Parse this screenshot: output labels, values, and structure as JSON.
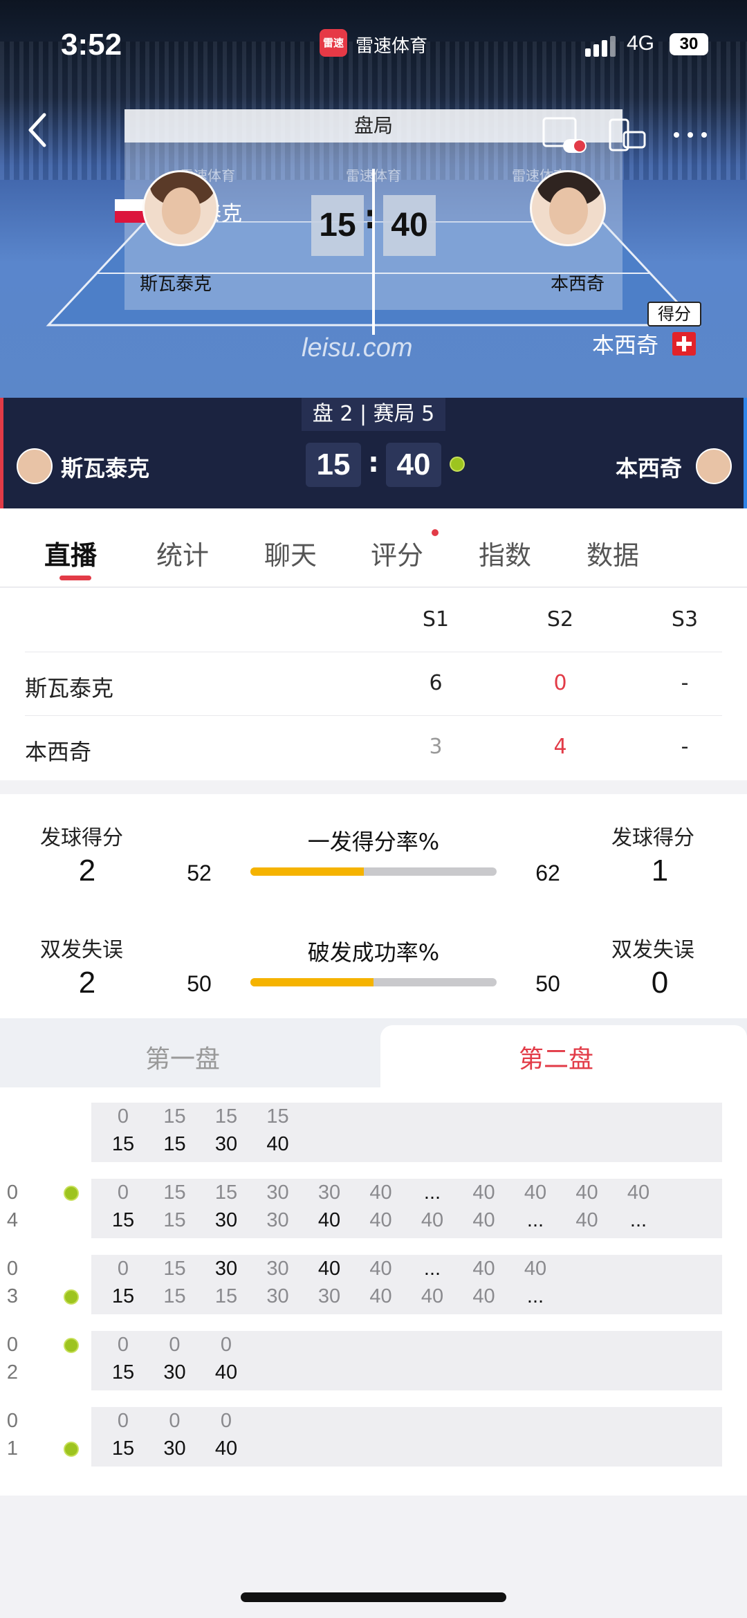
{
  "status_bar": {
    "time": "3:52",
    "app_name": "雷速体育",
    "app_logo_text": "雷速",
    "network": "4G",
    "battery": "30"
  },
  "hero": {
    "panel_title": "盘局",
    "watermarks": [
      "雷速体育",
      "雷速体育",
      "雷速体育"
    ],
    "player1_name": "斯瓦泰克",
    "player1_name_partial": "泰克",
    "player2_name": "本西奇",
    "score_left": "15",
    "score_right": "40",
    "colon": ":",
    "point_tag": "得分",
    "point_player": "本西奇",
    "site": "leisu.com"
  },
  "scorebar": {
    "set_game": "盘 2 | 赛局 5",
    "player1": "斯瓦泰克",
    "player2": "本西奇",
    "score_left": "15",
    "score_right": "40",
    "colon": ":"
  },
  "tabs": [
    "直播",
    "统计",
    "聊天",
    "评分",
    "指数",
    "数据"
  ],
  "active_tab": 0,
  "set_table": {
    "headers": [
      "S1",
      "S2",
      "S3"
    ],
    "rows": [
      {
        "name": "斯瓦泰克",
        "cells": [
          "6",
          "0",
          "-"
        ]
      },
      {
        "name": "本西奇",
        "cells": [
          "3",
          "4",
          "-"
        ]
      }
    ],
    "colors": {
      "highlight": "#e23b47",
      "muted": "#999999",
      "normal": "#222222"
    }
  },
  "stats": {
    "row1": {
      "left_label": "发球得分",
      "left_value": "2",
      "mid_label": "一发得分率%",
      "left_pct": "52",
      "right_pct": "62",
      "right_label": "发球得分",
      "right_value": "1",
      "fill": 0.46
    },
    "row2": {
      "left_label": "双发失误",
      "left_value": "2",
      "mid_label": "破发成功率%",
      "left_pct": "50",
      "right_pct": "50",
      "right_label": "双发失误",
      "right_value": "0",
      "fill": 0.5
    },
    "bar_color": "#f5b300"
  },
  "set_tabs": {
    "first": "第一盘",
    "second": "第二盘",
    "active": "second",
    "active_color": "#e23b47"
  },
  "games": [
    {
      "score_top": "",
      "score_bottom": "",
      "server": "none",
      "top": [
        "0",
        "15",
        "15",
        "15"
      ],
      "bottom": [
        "15",
        "15",
        "30",
        "40"
      ],
      "top_dark": [],
      "bottom_dark": [
        0,
        1,
        2,
        3
      ]
    },
    {
      "score_top": "0",
      "score_bottom": "4",
      "server": "top",
      "top": [
        "0",
        "15",
        "15",
        "30",
        "30",
        "40",
        "...",
        "40",
        "40",
        "40",
        "40"
      ],
      "bottom": [
        "15",
        "15",
        "30",
        "30",
        "40",
        "40",
        "40",
        "40",
        "...",
        "40",
        "..."
      ],
      "top_dark": [
        6
      ],
      "bottom_dark": [
        0,
        2,
        4,
        8,
        10
      ]
    },
    {
      "score_top": "0",
      "score_bottom": "3",
      "server": "bottom",
      "top": [
        "0",
        "15",
        "30",
        "30",
        "40",
        "40",
        "...",
        "40",
        "40"
      ],
      "bottom": [
        "15",
        "15",
        "15",
        "30",
        "30",
        "40",
        "40",
        "40",
        "..."
      ],
      "top_dark": [
        2,
        4,
        6
      ],
      "bottom_dark": [
        0,
        8
      ]
    },
    {
      "score_top": "0",
      "score_bottom": "2",
      "server": "top",
      "top": [
        "0",
        "0",
        "0"
      ],
      "bottom": [
        "15",
        "30",
        "40"
      ],
      "top_dark": [],
      "bottom_dark": [
        0,
        1,
        2
      ]
    },
    {
      "score_top": "0",
      "score_bottom": "1",
      "server": "bottom",
      "top": [
        "0",
        "0",
        "0"
      ],
      "bottom": [
        "15",
        "30",
        "40"
      ],
      "top_dark": [],
      "bottom_dark": [
        0,
        1,
        2
      ]
    }
  ]
}
